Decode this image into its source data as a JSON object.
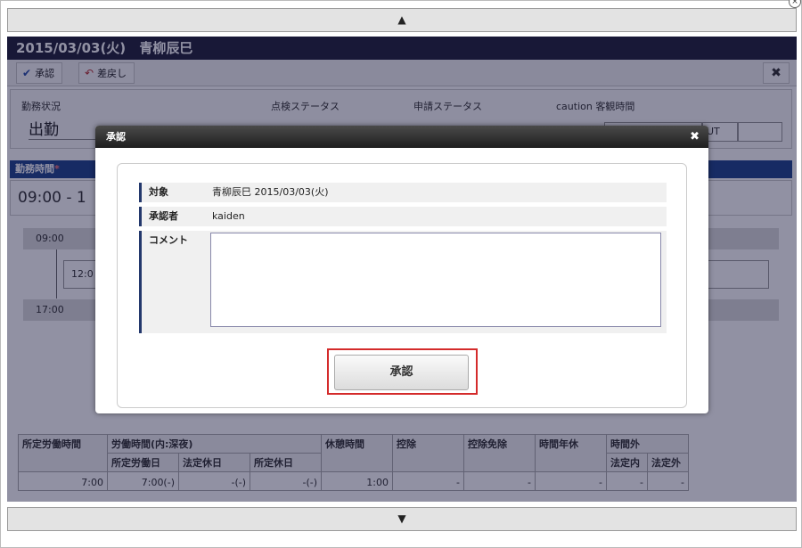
{
  "scroll": {
    "up": "▲",
    "down": "▼"
  },
  "background": {
    "header": {
      "date": "2015/03/03(火)",
      "name": "青柳辰巳"
    },
    "toolbar": {
      "approve": "承認",
      "reject": "差戻し",
      "close_icon": "✖"
    },
    "status": {
      "work_status_label": "勤務状況",
      "work_status_value": "出勤",
      "check_status_label": "点検ステータス",
      "request_status_label": "申請ステータス",
      "caution_label": "caution 客観時間",
      "out_label": "UT"
    },
    "section": {
      "title": "勤務時間",
      "required_mark": "*"
    },
    "time_row": "09:00  -  1",
    "timeline": {
      "start": "09:00",
      "middle": "12:0",
      "end": "17:00"
    },
    "summary": {
      "headers": {
        "prescribed": "所定労働時間",
        "work_time": "労働時間(内:深夜)",
        "prescribed_workday": "所定労働日",
        "legal_holiday": "法定休日",
        "prescribed_holiday": "所定休日",
        "break": "休憩時間",
        "deduction": "控除",
        "deduction_exempt": "控除免除",
        "annual_hours": "時間年休",
        "overtime": "時間外",
        "within_legal": "法定内",
        "outside_legal": "法定外"
      },
      "values": [
        "7:00",
        "7:00(-)",
        "-(-)",
        "-(-)",
        "1:00",
        "-",
        "-",
        "-",
        "-",
        "-"
      ]
    }
  },
  "modal": {
    "title": "承認",
    "close_icon": "✖",
    "fields": {
      "target_label": "対象",
      "target_value": "青柳辰巳 2015/03/03(火)",
      "approver_label": "承認者",
      "approver_value": "kaiden",
      "comment_label": "コメント",
      "comment_value": ""
    },
    "approve_button": "承認"
  }
}
